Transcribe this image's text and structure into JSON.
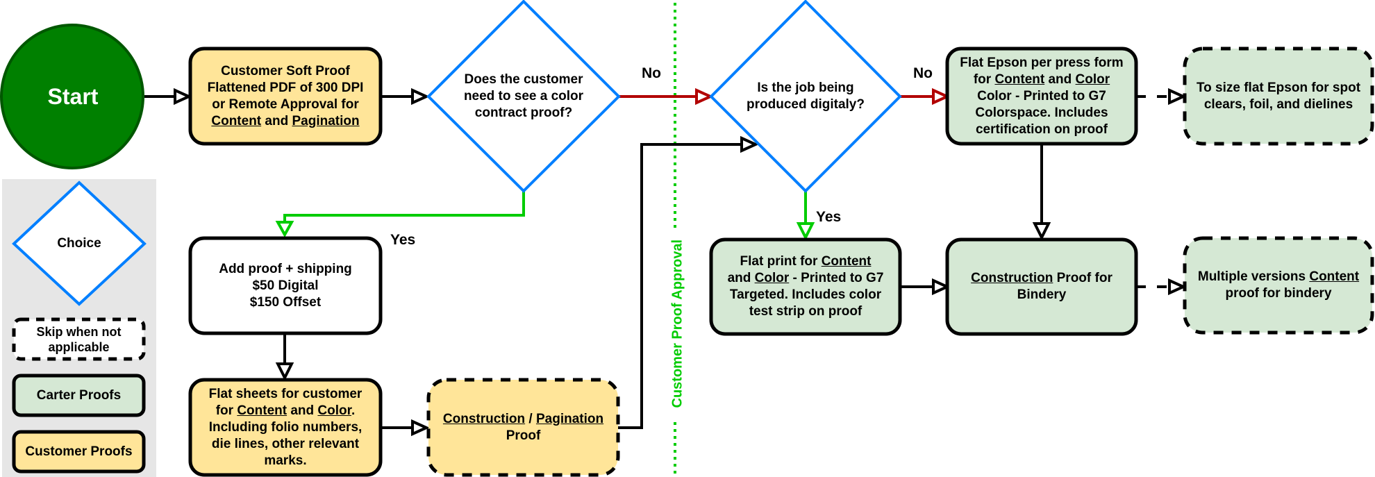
{
  "diagram": {
    "start": {
      "label": "Start"
    },
    "nodes": {
      "soft_proof": {
        "lines": [
          "Customer Soft Proof",
          "Flattened PDF of 300 DPI",
          "or Remote Approval for",
          "[Content] and [Pagination]"
        ],
        "type": "customer"
      },
      "decision_color": {
        "lines": [
          "Does the customer",
          "need to see a color",
          "contract proof?"
        ],
        "type": "choice"
      },
      "add_proof": {
        "lines": [
          "Add proof + shipping",
          "$50 Digital",
          "$150 Offset"
        ],
        "type": "plain"
      },
      "flat_sheets": {
        "lines": [
          "Flat sheets for customer",
          "for [Content] and [Color].",
          "Including folio numbers,",
          "die lines, other relevant",
          "marks."
        ],
        "type": "customer"
      },
      "construction_pagination": {
        "lines": [
          "[Construction] / [Pagination]",
          "Proof"
        ],
        "type": "customer-skip"
      },
      "decision_digital": {
        "lines": [
          "Is the job being",
          "produced digitaly?"
        ],
        "type": "choice"
      },
      "flat_print": {
        "lines": [
          "Flat print for [Content]",
          "and [Color] - Printed to G7",
          "Targeted. Includes color",
          "test strip on proof"
        ],
        "type": "carter"
      },
      "flat_epson": {
        "lines": [
          "Flat Epson per press form",
          "for [Content] and [Color]",
          "Color - Printed to G7",
          "Colorspace. Includes",
          "certification on proof"
        ],
        "type": "carter"
      },
      "to_size_epson": {
        "lines": [
          "To size flat Epson for spot",
          "clears, foil, and dielines"
        ],
        "type": "carter-skip"
      },
      "construction_bindery": {
        "lines": [
          "[Construction] Proof for",
          "Bindery"
        ],
        "type": "carter"
      },
      "multiple_versions": {
        "lines": [
          "Multiple versions [Content]",
          "proof for bindery"
        ],
        "type": "carter-skip"
      }
    },
    "edge_labels": {
      "no_1": "No",
      "yes_1": "Yes",
      "no_2": "No",
      "yes_2": "Yes"
    },
    "divider_label": "Customer Proof Approval",
    "legend": {
      "choice": "Choice",
      "skip": "Skip when not applicable",
      "skip_lines": [
        "Skip when not",
        "applicable"
      ],
      "carter": "Carter Proofs",
      "customer": "Customer Proofs"
    },
    "colors": {
      "start_fill": "#008000",
      "start_stroke": "#005700",
      "customer_fill": "#ffe599",
      "carter_fill": "#d5e8d4",
      "choice_stroke": "#007fff",
      "yes_edge": "#00cc00",
      "no_edge": "#b20000",
      "divider": "#00cc00",
      "legend_bg": "#e6e6e6"
    }
  }
}
